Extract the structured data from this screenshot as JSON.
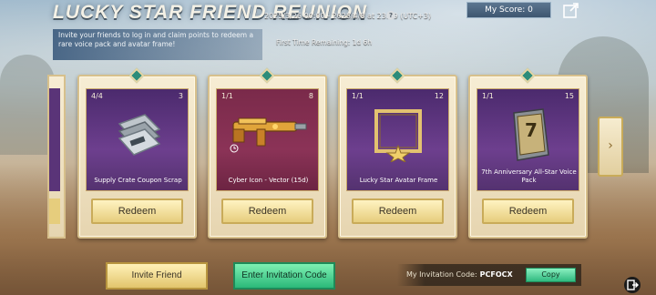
{
  "header": {
    "title": "LUCKY STAR FRIEND REUNION",
    "timeline": "2025/3/26 00:00 - 2025/4/8 at 23:59 (UTC+3)",
    "description": "Invite your friends to log in and claim points to redeem a rare voice pack and avatar frame!",
    "first_time_remaining": "First Time Remaining: 1d 6h",
    "score_label": "My Score: 0"
  },
  "cards": [
    {
      "count": "4/4",
      "points": "3",
      "name": "Supply Crate Coupon Scrap",
      "redeem_label": "Redeem"
    },
    {
      "count": "1/1",
      "points": "8",
      "name": "Cyber Icon - Vector (15d)",
      "redeem_label": "Redeem"
    },
    {
      "count": "1/1",
      "points": "12",
      "name": "Lucky Star Avatar Frame",
      "redeem_label": "Redeem"
    },
    {
      "count": "1/1",
      "points": "15",
      "name": "7th Anniversary All-Star Voice Pack",
      "redeem_label": "Redeem"
    }
  ],
  "footer": {
    "invite_label": "Invite Friend",
    "enter_code_label": "Enter Invitation Code",
    "my_code_label": "My Invitation Code:",
    "my_code_value": "PCFOCX",
    "copy_label": "Copy"
  },
  "icons": {
    "info": "info-icon",
    "share": "share-icon",
    "next": "chevron-right-icon",
    "exit": "exit-icon"
  },
  "colors": {
    "accent_gold": "#e6cd7d",
    "accent_green": "#2bb879",
    "card_purple": "#6d3f8e",
    "card_red": "#8b3357"
  }
}
